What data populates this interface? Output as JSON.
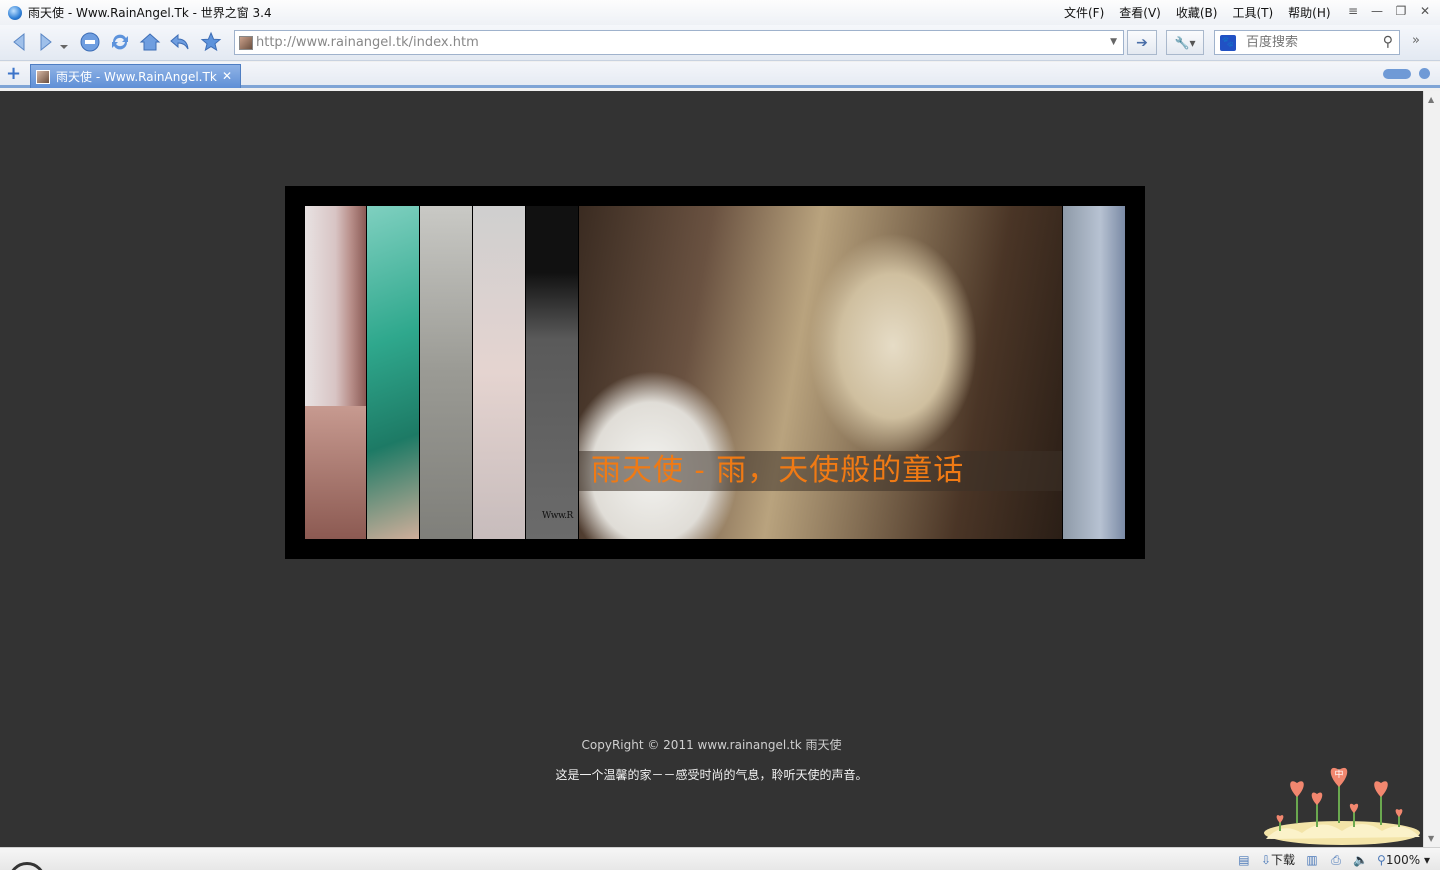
{
  "window": {
    "title": "雨天使 - Www.RainAngel.Tk - 世界之窗 3.4"
  },
  "menu": {
    "items": [
      "文件(F)",
      "查看(V)",
      "收藏(B)",
      "工具(T)",
      "帮助(H)"
    ]
  },
  "toolbar": {
    "address": "http://www.rainangel.tk/index.htm",
    "search_placeholder": "百度搜索"
  },
  "tabs": [
    {
      "label": "雨天使 - Www.RainAngel.Tk",
      "active": true
    }
  ],
  "page": {
    "background": "#333333",
    "banner_caption": "雨天使 - 雨，天使般的童话",
    "caption_color": "#f07a14",
    "strip_tag": "Www.R",
    "copyright": "CopyRight © 2011 www.rainangel.tk 雨天使",
    "tagline": "这是一个温馨的家－－感受时尚的气息，聆听天使的声音。",
    "flower_badge": "中"
  },
  "statusbar": {
    "download_label": "下载",
    "zoom": "100%"
  },
  "icons": {
    "back": "back-arrow-icon",
    "forward": "forward-arrow-icon",
    "stop": "stop-icon",
    "refresh": "refresh-icon",
    "home": "home-icon",
    "undo": "undo-close-icon",
    "favorite": "star-icon"
  }
}
